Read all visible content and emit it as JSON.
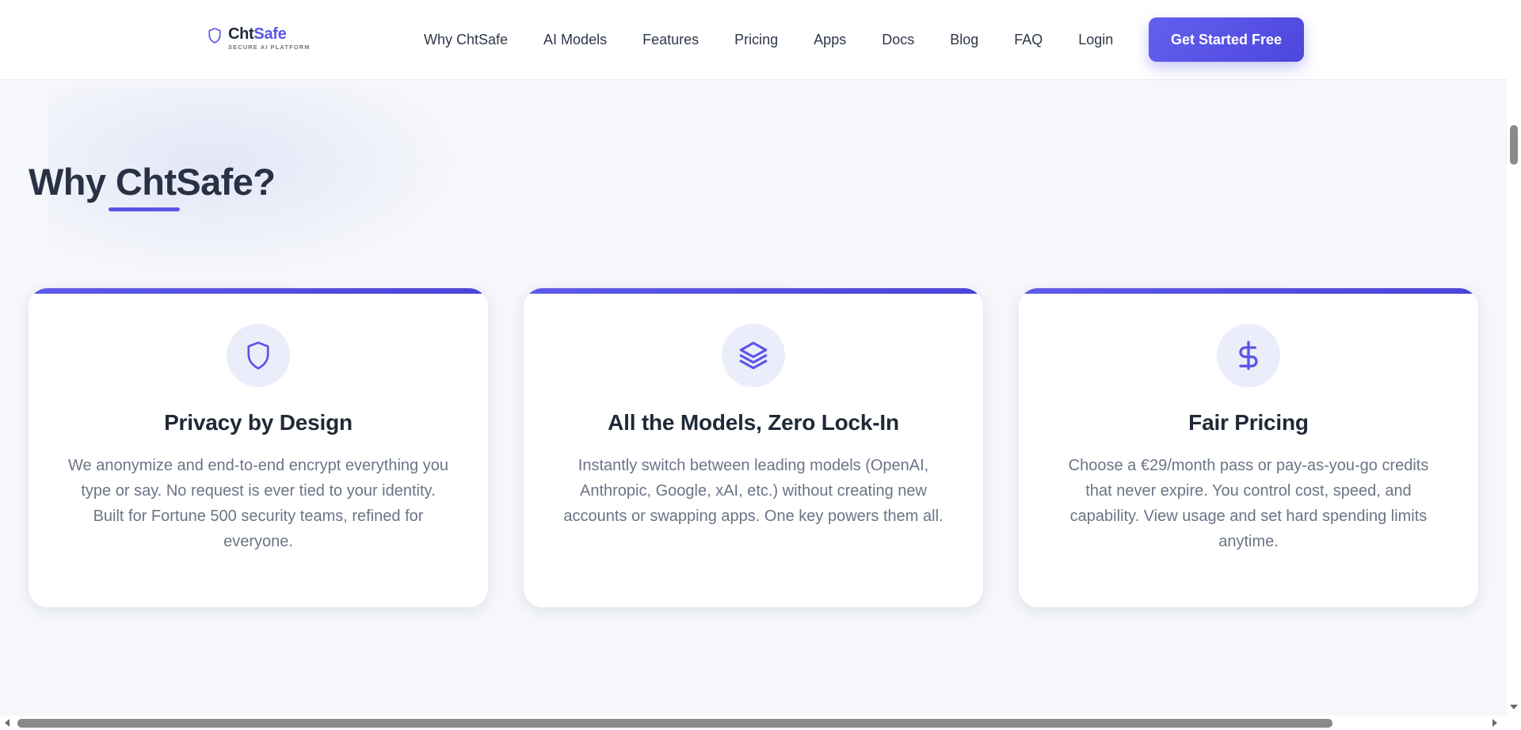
{
  "header": {
    "logo": {
      "name_part1": "Cht",
      "name_part2": "Safe",
      "tagline": "SECURE AI PLATFORM",
      "icon": "shield-icon"
    },
    "nav": [
      {
        "label": "Why ChtSafe"
      },
      {
        "label": "AI Models"
      },
      {
        "label": "Features"
      },
      {
        "label": "Pricing"
      },
      {
        "label": "Apps"
      },
      {
        "label": "Docs"
      },
      {
        "label": "Blog"
      },
      {
        "label": "FAQ"
      },
      {
        "label": "Login"
      }
    ],
    "cta_label": "Get Started Free"
  },
  "section": {
    "title": "Why ChtSafe?",
    "cards": [
      {
        "icon": "shield-icon",
        "title": "Privacy by Design",
        "description": "We anonymize and end-to-end encrypt everything you type or say. No request is ever tied to your identity. Built for Fortune 500 security teams, refined for everyone."
      },
      {
        "icon": "layers-icon",
        "title": "All the Models, Zero Lock-In",
        "description": "Instantly switch between leading models (OpenAI, Anthropic, Google, xAI, etc.) without creating new accounts or swapping apps. One key powers them all."
      },
      {
        "icon": "dollar-icon",
        "title": "Fair Pricing",
        "description": "Choose a €29/month pass or pay-as-you-go credits that never expire. You control cost, speed, and capability. View usage and set hard spending limits anytime."
      }
    ]
  },
  "colors": {
    "accent": "#5b55e6",
    "background": "#f5f7fb",
    "card_background": "#ffffff",
    "icon_background": "#ecedfb",
    "text_heading": "#1f2937",
    "text_body": "#6b7486"
  }
}
